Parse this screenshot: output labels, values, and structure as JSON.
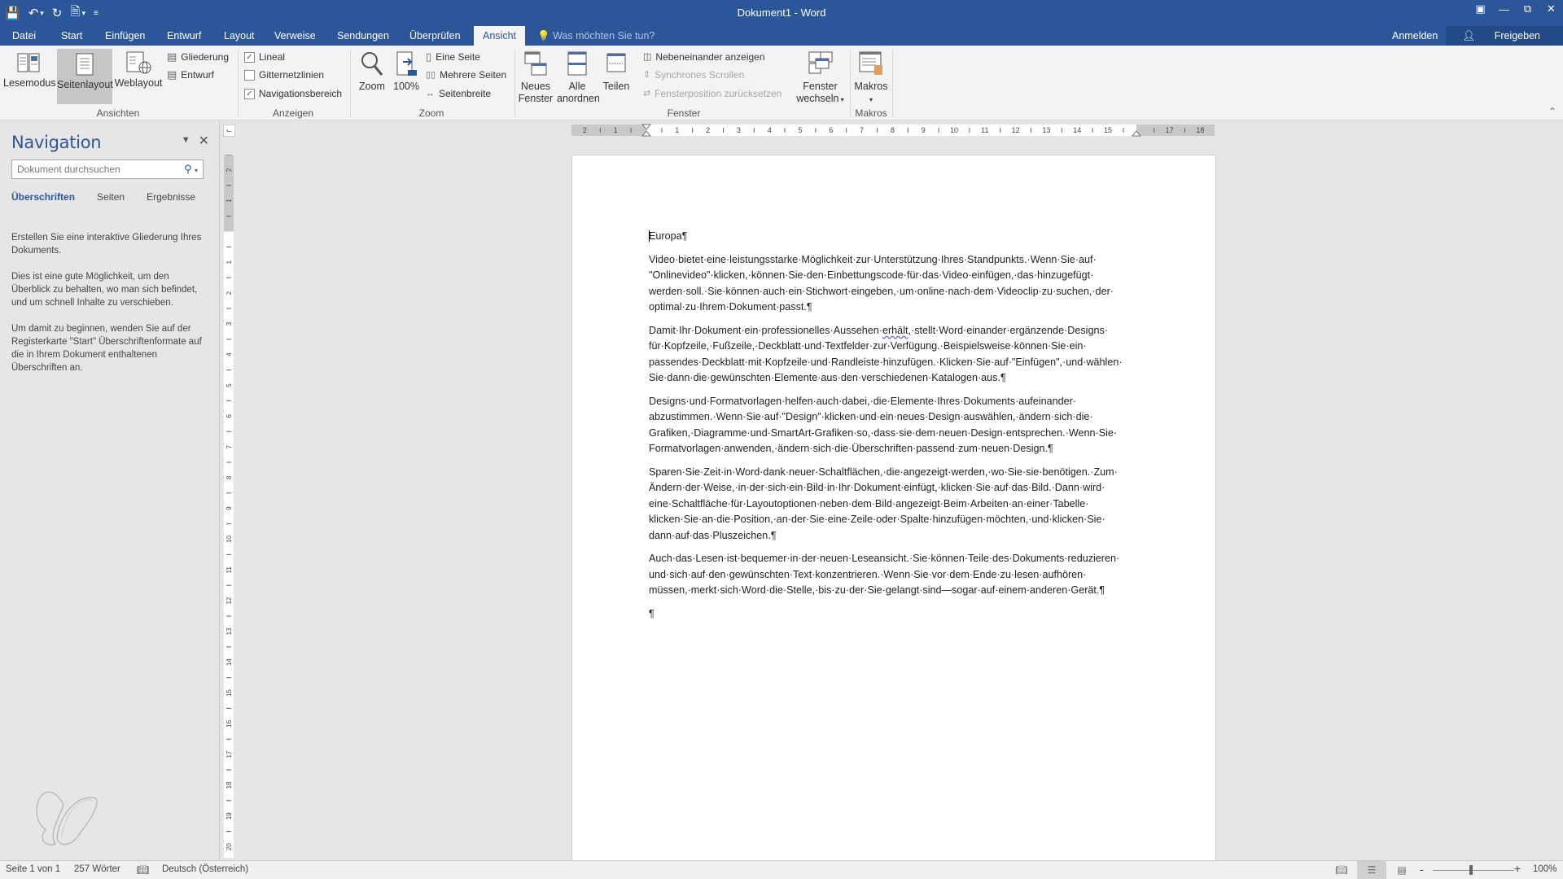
{
  "window": {
    "title": "Dokument1 - Word",
    "controls": [
      "ribbon-display-icon",
      "minimize-icon",
      "restore-icon",
      "close-icon"
    ]
  },
  "qat": {
    "save": "save-icon",
    "undo": "undo-icon",
    "redo": "redo-icon",
    "new": "new-document-icon",
    "customize": "customize-qat-icon"
  },
  "tabs": [
    {
      "label": "Datei"
    },
    {
      "label": "Start"
    },
    {
      "label": "Einfügen"
    },
    {
      "label": "Entwurf"
    },
    {
      "label": "Layout"
    },
    {
      "label": "Verweise"
    },
    {
      "label": "Sendungen"
    },
    {
      "label": "Überprüfen"
    },
    {
      "label": "Ansicht",
      "active": true
    }
  ],
  "tellme": "Was möchten Sie tun?",
  "account": {
    "signin": "Anmelden",
    "share": "Freigeben"
  },
  "ribbon": {
    "ansichten": {
      "label": "Ansichten",
      "lesemodus": "Lesemodus",
      "seitenlayout": "Seitenlayout",
      "weblayout": "Weblayout",
      "gliederung": "Gliederung",
      "entwurf": "Entwurf"
    },
    "anzeigen": {
      "label": "Anzeigen",
      "lineal": {
        "label": "Lineal",
        "checked": true
      },
      "gitternetzlinien": {
        "label": "Gitternetzlinien",
        "checked": false
      },
      "navigationsbereich": {
        "label": "Navigationsbereich",
        "checked": true
      }
    },
    "zoom": {
      "label": "Zoom",
      "zoom": "Zoom",
      "hundred": "100%",
      "eine_seite": "Eine Seite",
      "mehrere_seiten": "Mehrere Seiten",
      "seitenbreite": "Seitenbreite"
    },
    "fenster": {
      "label": "Fenster",
      "neues_fenster_1": "Neues",
      "neues_fenster_2": "Fenster",
      "alle_anordnen_1": "Alle",
      "alle_anordnen_2": "anordnen",
      "teilen": "Teilen",
      "nebeneinander": "Nebeneinander anzeigen",
      "synchrones": "Synchrones Scrollen",
      "fensterposition": "Fensterposition zurücksetzen",
      "fenster_wechseln_1": "Fenster",
      "fenster_wechseln_2": "wechseln"
    },
    "makros": {
      "label": "Makros",
      "button": "Makros"
    }
  },
  "navigation": {
    "title": "Navigation",
    "search_placeholder": "Dokument durchsuchen",
    "tabs": [
      "Überschriften",
      "Seiten",
      "Ergebnisse"
    ],
    "active_tab": "Überschriften",
    "help": [
      "Erstellen Sie eine interaktive Gliederung Ihres Dokuments.",
      "Dies ist eine gute Möglichkeit, um den Überblick zu behalten, wo man sich befindet, und um schnell Inhalte zu verschieben.",
      "Um damit zu beginnen, wenden Sie auf der Registerkarte \"Start\" Überschriftenformate auf die in Ihrem Dokument enthaltenen Überschriften an."
    ]
  },
  "ruler": {
    "horizontal_labels": [
      "2",
      "1",
      "1",
      "2",
      "3",
      "4",
      "5",
      "6",
      "7",
      "8",
      "9",
      "10",
      "11",
      "12",
      "13",
      "14",
      "15",
      "17",
      "18"
    ],
    "vertical_labels": [
      "2",
      "1",
      "1",
      "2",
      "3",
      "4",
      "5",
      "6",
      "7",
      "8",
      "9",
      "10",
      "11",
      "12",
      "13",
      "14",
      "15",
      "16",
      "17",
      "18",
      "19",
      "20"
    ]
  },
  "document": {
    "heading": "Europa¶",
    "paragraphs": [
      "Video·bietet·eine·leistungsstarke·Möglichkeit·zur·Unterstützung·Ihres·Standpunkts.·Wenn·Sie·auf· \"Onlinevideo\"·klicken,·können·Sie·den·Einbettungscode·für·das·Video·einfügen,·das·hinzugefügt· werden·soll.·Sie·können·auch·ein·Stichwort·eingeben,·um·online·nach·dem·Videoclip·zu·suchen,·der· optimal·zu·Ihrem·Dokument·passt.¶",
      "Damit·Ihr·Dokument·ein·professionelles·Aussehen·erhält,·stellt·Word·einander·ergänzende·Designs· für·Kopfzeile,·Fußzeile,·Deckblatt·und·Textfelder·zur·Verfügung.·Beispielsweise·können·Sie·ein· passendes·Deckblatt·mit·Kopfzeile·und·Randleiste·hinzufügen.·Klicken·Sie·auf·\"Einfügen\",·und·wählen· Sie·dann·die·gewünschten·Elemente·aus·den·verschiedenen·Katalogen·aus.¶",
      "Designs·und·Formatvorlagen·helfen·auch·dabei,·die·Elemente·Ihres·Dokuments·aufeinander· abzustimmen.·Wenn·Sie·auf·\"Design\"·klicken·und·ein·neues·Design·auswählen,·ändern·sich·die· Grafiken,·Diagramme·und·SmartArt-Grafiken·so,·dass·sie·dem·neuen·Design·entsprechen.·Wenn·Sie· Formatvorlagen·anwenden,·ändern·sich·die·Überschriften·passend·zum·neuen·Design.¶",
      "Sparen·Sie·Zeit·in·Word·dank·neuer·Schaltflächen,·die·angezeigt·werden,·wo·Sie·sie·benötigen.·Zum· Ändern·der·Weise,·in·der·sich·ein·Bild·in·Ihr·Dokument·einfügt,·klicken·Sie·auf·das·Bild.·Dann·wird· eine·Schaltfläche·für·Layoutoptionen·neben·dem·Bild·angezeigt·Beim·Arbeiten·an·einer·Tabelle· klicken·Sie·an·die·Position,·an·der·Sie·eine·Zeile·oder·Spalte·hinzufügen·möchten,·und·klicken·Sie· dann·auf·das·Pluszeichen.¶",
      "Auch·das·Lesen·ist·bequemer·in·der·neuen·Leseansicht.·Sie·können·Teile·des·Dokuments·reduzieren· und·sich·auf·den·gewünschten·Text·konzentrieren.·Wenn·Sie·vor·dem·Ende·zu·lesen·aufhören· müssen,·merkt·sich·Word·die·Stelle,·bis·zu·der·Sie·gelangt·sind—sogar·auf·einem·anderen·Gerät.¶",
      "¶"
    ],
    "p2_before": "Damit·Ihr·Dokument·ein·professionelles·Aussehen·",
    "p2_squiggle": "erhält",
    "p2_after": ",·stellt·Word·einander·ergänzende·Designs· für·Kopfzeile,·Fußzeile,·Deckblatt·und·Textfelder·zur·Verfügung.·Beispielsweise·können·Sie·ein· passendes·Deckblatt·mit·Kopfzeile·und·Randleiste·hinzufügen.·Klicken·Sie·auf·\"Einfügen\",·und·wählen· Sie·dann·die·gewünschten·Elemente·aus·den·verschiedenen·Katalogen·aus.¶"
  },
  "status": {
    "page": "Seite 1 von 1",
    "words": "257 Wörter",
    "proofing_icon": "proofing-errors-icon",
    "language": "Deutsch (Österreich)",
    "zoom": "100%",
    "zoom_level_percent": 100,
    "zoom_minus": "-",
    "zoom_plus": "+"
  }
}
